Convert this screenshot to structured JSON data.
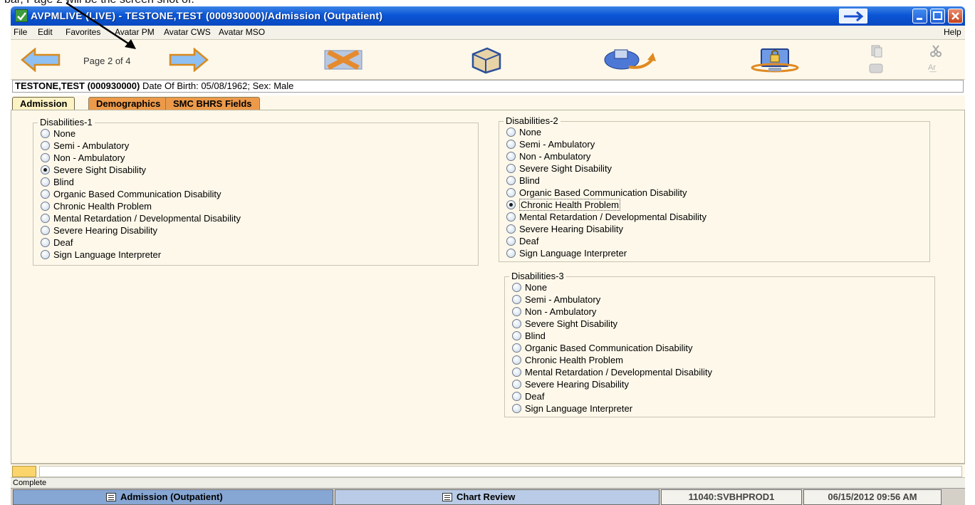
{
  "doc_caption": "bar, Page 2 will be the screen shot of.",
  "window": {
    "title": "AVPMLIVE (LIVE) - TESTONE,TEST (000930000)/Admission (Outpatient)"
  },
  "menu": [
    "File",
    "Edit",
    "Favorites",
    "Avatar PM",
    "Avatar CWS",
    "Avatar MSO"
  ],
  "menu_help": "Help",
  "toolbar": {
    "page_label": "Page 2 of 4"
  },
  "patient": {
    "name": "TESTONE,TEST (000930000)",
    "details": " Date Of Birth: 05/08/1962; Sex: Male"
  },
  "tabs": [
    "Admission",
    "Demographics",
    "SMC BHRS Fields"
  ],
  "groups": [
    {
      "title": "Disabilities-1",
      "options": [
        "None",
        "Semi - Ambulatory",
        "Non - Ambulatory",
        "Severe Sight Disability",
        "Blind",
        "Organic Based Communication Disability",
        "Chronic Health Problem",
        "Mental Retardation / Developmental Disability",
        "Severe Hearing Disability",
        "Deaf",
        "Sign Language Interpreter"
      ],
      "selected": "Severe Sight Disability"
    },
    {
      "title": "Disabilities-2",
      "options": [
        "None",
        "Semi - Ambulatory",
        "Non - Ambulatory",
        "Severe Sight Disability",
        "Blind",
        "Organic Based Communication Disability",
        "Chronic Health Problem",
        "Mental Retardation / Developmental Disability",
        "Severe Hearing Disability",
        "Deaf",
        "Sign Language Interpreter"
      ],
      "selected": "Chronic Health Problem"
    },
    {
      "title": "Disabilities-3",
      "options": [
        "None",
        "Semi - Ambulatory",
        "Non - Ambulatory",
        "Severe Sight Disability",
        "Blind",
        "Organic Based Communication Disability",
        "Chronic Health Problem",
        "Mental Retardation / Developmental Disability",
        "Severe Hearing Disability",
        "Deaf",
        "Sign Language Interpreter"
      ],
      "selected": ""
    }
  ],
  "status": "Complete",
  "taskbar": {
    "admission": "Admission (Outpatient)",
    "chart_review": "Chart Review",
    "server": "11040:SVBHPROD1",
    "datetime": "06/15/2012 09:56 AM"
  },
  "icons": {
    "prev": "arrow-left-icon",
    "next": "arrow-right-icon",
    "discard": "x-close-icon",
    "submit": "box-icon",
    "launch": "disk-arrow-icon",
    "lock": "computer-lock-icon"
  },
  "colors": {
    "titlebar": "#0a55d6",
    "tab_active": "#fdf2c4",
    "tab_inactive": "#ec9a4a",
    "panel": "#fdf8ea"
  }
}
